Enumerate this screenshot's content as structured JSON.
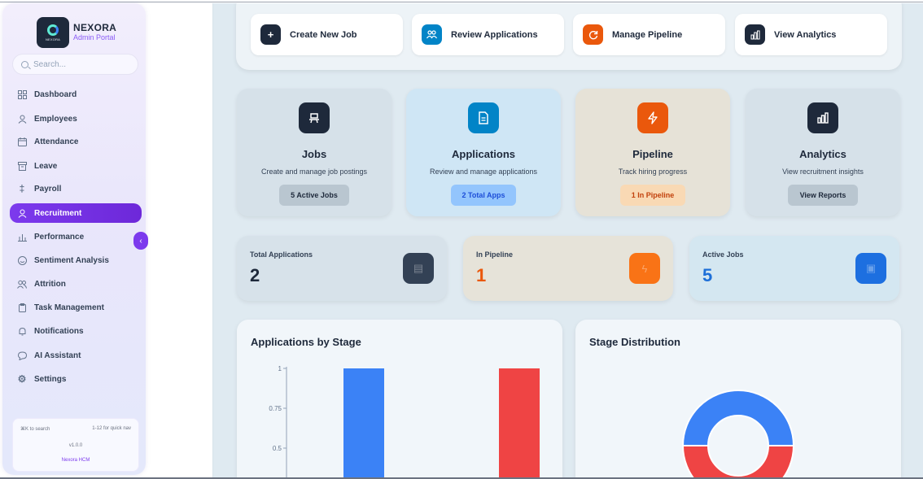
{
  "brand": {
    "name": "NEXORA",
    "subtitle": "Admin Portal",
    "logo_text": "NEXORA"
  },
  "search": {
    "placeholder": "Search..."
  },
  "nav": [
    {
      "label": "Dashboard",
      "icon": "grid-icon"
    },
    {
      "label": "Employees",
      "icon": "user-icon"
    },
    {
      "label": "Attendance",
      "icon": "calendar-icon"
    },
    {
      "label": "Leave",
      "icon": "archive-icon"
    },
    {
      "label": "Payroll",
      "icon": "dollar-icon"
    },
    {
      "label": "Recruitment",
      "icon": "user-icon",
      "active": true
    },
    {
      "label": "Performance",
      "icon": "bar-icon"
    },
    {
      "label": "Sentiment Analysis",
      "icon": "smile-icon"
    },
    {
      "label": "Attrition",
      "icon": "users-icon"
    },
    {
      "label": "Task Management",
      "icon": "clipboard-icon"
    },
    {
      "label": "Notifications",
      "icon": "bell-icon"
    },
    {
      "label": "AI Assistant",
      "icon": "chat-icon"
    },
    {
      "label": "Settings",
      "icon": "gear-icon"
    }
  ],
  "sidebar_footer": {
    "shortcut_search": "⌘K to search",
    "shortcut_nav": "1-12 for quick nav",
    "version": "v1.0.0",
    "product": "Nexora HCM"
  },
  "quick_actions": [
    {
      "label": "Create New Job",
      "icon": "plus-icon",
      "color": "#1e293b"
    },
    {
      "label": "Review Applications",
      "icon": "people-icon",
      "color": "#0284c7"
    },
    {
      "label": "Manage Pipeline",
      "icon": "refresh-icon",
      "color": "#ea580c"
    },
    {
      "label": "View Analytics",
      "icon": "chart-icon",
      "color": "#1e293b"
    }
  ],
  "modules": [
    {
      "title": "Jobs",
      "desc": "Create and manage job postings",
      "button": "5 Active Jobs",
      "icon": "briefcase-icon",
      "icon_color": "#1e293b",
      "bg": "#d6e1e9",
      "btn_bg": "#b9c6d0",
      "btn_color": "#1e293b"
    },
    {
      "title": "Applications",
      "desc": "Review and manage applications",
      "button": "2 Total Apps",
      "icon": "document-icon",
      "icon_color": "#0284c7",
      "bg": "#cfe6f5",
      "btn_bg": "#93c5fd",
      "btn_color": "#1d4ed8"
    },
    {
      "title": "Pipeline",
      "desc": "Track hiring progress",
      "button": "1 In Pipeline",
      "icon": "bolt-icon",
      "icon_color": "#ea580c",
      "bg": "#e6e2d7",
      "btn_bg": "#f9d9b4",
      "btn_color": "#c2410c"
    },
    {
      "title": "Analytics",
      "desc": "View recruitment insights",
      "button": "View Reports",
      "icon": "chart-icon",
      "icon_color": "#1e293b",
      "bg": "#d6e1e9",
      "btn_bg": "#b9c6d0",
      "btn_color": "#1e293b"
    }
  ],
  "stats": [
    {
      "label": "Total Applications",
      "value": "2",
      "value_color": "#1e293b",
      "bg": "#d7e2ea",
      "icon_color": "#334155",
      "icon": "document-icon"
    },
    {
      "label": "In Pipeline",
      "value": "1",
      "value_color": "#ea580c",
      "bg": "#e6e3d9",
      "icon_color": "#f97316",
      "icon": "bolt-icon"
    },
    {
      "label": "Active Jobs",
      "value": "5",
      "value_color": "#1d6fd8",
      "bg": "#d4e7f1",
      "icon_color": "#1d6fe0",
      "icon": "briefcase-icon"
    }
  ],
  "charts_titles": {
    "stage_title": "Applications by Stage",
    "distribution_title": "Stage Distribution"
  },
  "chart_data": [
    {
      "type": "bar",
      "title": "Applications by Stage",
      "categories": [
        "",
        ""
      ],
      "values": [
        1,
        1
      ],
      "colors": [
        "#3b82f6",
        "#ef4444"
      ],
      "ylim": [
        0,
        1
      ],
      "y_ticks": [
        "1",
        "0.75",
        "0.5"
      ],
      "grid": false
    },
    {
      "type": "pie",
      "title": "Stage Distribution",
      "values": [
        1,
        1
      ],
      "colors": [
        "#3b82f6",
        "#ef4444"
      ],
      "donut": true
    }
  ]
}
